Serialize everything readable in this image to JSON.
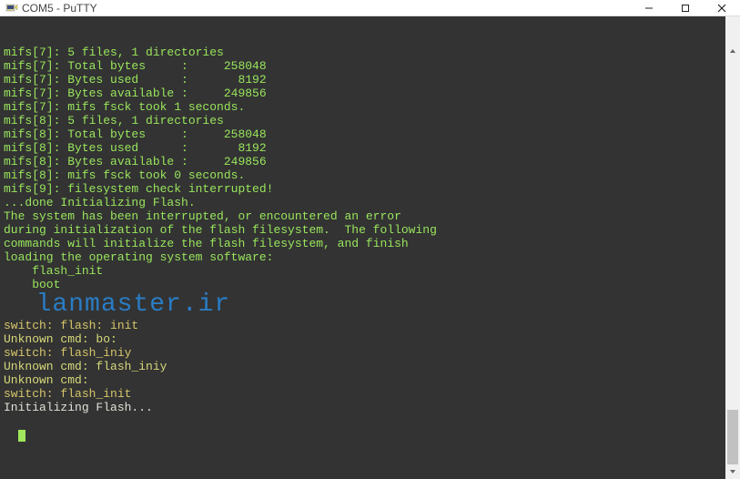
{
  "window": {
    "title": "COM5 - PuTTY"
  },
  "terminal": {
    "lines": [
      {
        "cls": "c-lime",
        "text": "mifs[7]: 5 files, 1 directories"
      },
      {
        "cls": "c-lime",
        "text": "mifs[7]: Total bytes     :     258048"
      },
      {
        "cls": "c-lime",
        "text": "mifs[7]: Bytes used      :       8192"
      },
      {
        "cls": "c-lime",
        "text": "mifs[7]: Bytes available :     249856"
      },
      {
        "cls": "c-lime",
        "text": "mifs[7]: mifs fsck took 1 seconds."
      },
      {
        "cls": "c-lime",
        "text": "mifs[8]: 5 files, 1 directories"
      },
      {
        "cls": "c-lime",
        "text": "mifs[8]: Total bytes     :     258048"
      },
      {
        "cls": "c-lime",
        "text": "mifs[8]: Bytes used      :       8192"
      },
      {
        "cls": "c-lime",
        "text": "mifs[8]: Bytes available :     249856"
      },
      {
        "cls": "c-lime",
        "text": "mifs[8]: mifs fsck took 0 seconds."
      },
      {
        "cls": "c-lime",
        "text": "mifs[9]: filesystem check interrupted!"
      },
      {
        "cls": "c-lime",
        "text": "...done Initializing Flash."
      },
      {
        "cls": "c-lime",
        "text": ""
      },
      {
        "cls": "c-lime",
        "text": "The system has been interrupted, or encountered an error"
      },
      {
        "cls": "c-lime",
        "text": "during initialization of the flash filesystem.  The following"
      },
      {
        "cls": "c-lime",
        "text": "commands will initialize the flash filesystem, and finish"
      },
      {
        "cls": "c-lime",
        "text": "loading the operating system software:"
      },
      {
        "cls": "c-lime",
        "text": ""
      },
      {
        "cls": "c-lime",
        "text": "    flash_init"
      },
      {
        "cls": "c-lime",
        "text": "    boot"
      },
      {
        "cls": "c-blu",
        "text": "  lanmaster.ir"
      },
      {
        "cls": "c-ylw",
        "text": "switch: flash: init"
      },
      {
        "cls": "c-yel",
        "text": "Unknown cmd: bo:"
      },
      {
        "cls": "c-yel",
        "text": ""
      },
      {
        "cls": "c-yel",
        "text": ""
      },
      {
        "cls": "c-ylw",
        "text": "switch: flash_iniy"
      },
      {
        "cls": "c-yel",
        "text": "Unknown cmd: flash_iniy"
      },
      {
        "cls": "c-yel",
        "text": ""
      },
      {
        "cls": "c-yel",
        "text": "Unknown cmd:"
      },
      {
        "cls": "c-ylw",
        "text": "switch: flash_init"
      },
      {
        "cls": "c-wht",
        "text": "Initializing Flash..."
      }
    ]
  },
  "scrollbar": {
    "thumb_top_pct": 85,
    "thumb_height_pct": 12
  }
}
